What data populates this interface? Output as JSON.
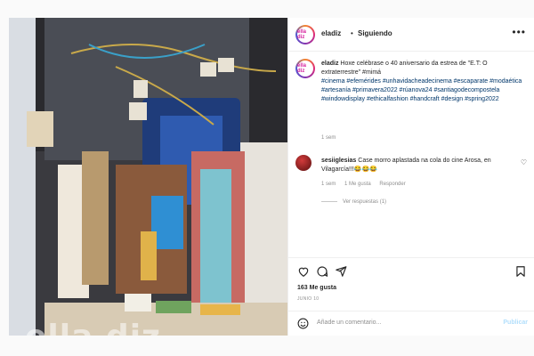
{
  "header": {
    "username": "eladiz",
    "separator": "•",
    "follow_state": "Siguiendo",
    "more": "•••",
    "avatar_text": "ella diz"
  },
  "caption": {
    "username": "eladiz",
    "text": "Hoxe celébrase o 40 aniversario da estrea de \"E.T: O extraterrestre\" #mimá",
    "tags": "#cinema #efemérides #unhavidacheadecinema #escaparate #modaética #artesanía #primavera2022 #rúanova24 #santiagodecompostela #windowdisplay #ethicalfashion #handcraft #design #spring2022",
    "time": "1 sem"
  },
  "comment": {
    "username": "sesiiglesias",
    "text": "Case morro aplastada na cola do cine Arosa, en Vilagarcía!!!😂😂😂",
    "time": "1 sem",
    "likes": "1 Me gusta",
    "reply": "Responder",
    "replies": "Ver respuestas (1)"
  },
  "post": {
    "likes": "163 Me gusta",
    "date": "JUNIO 10"
  },
  "add_comment": {
    "placeholder": "Añade un comentario...",
    "post_label": "Publicar"
  },
  "photo": {
    "watermark": "ella diz"
  },
  "icons": {
    "heart": "heart-icon",
    "comment": "comment-icon",
    "share": "share-icon",
    "save": "bookmark-icon",
    "emoji": "emoji-icon"
  }
}
